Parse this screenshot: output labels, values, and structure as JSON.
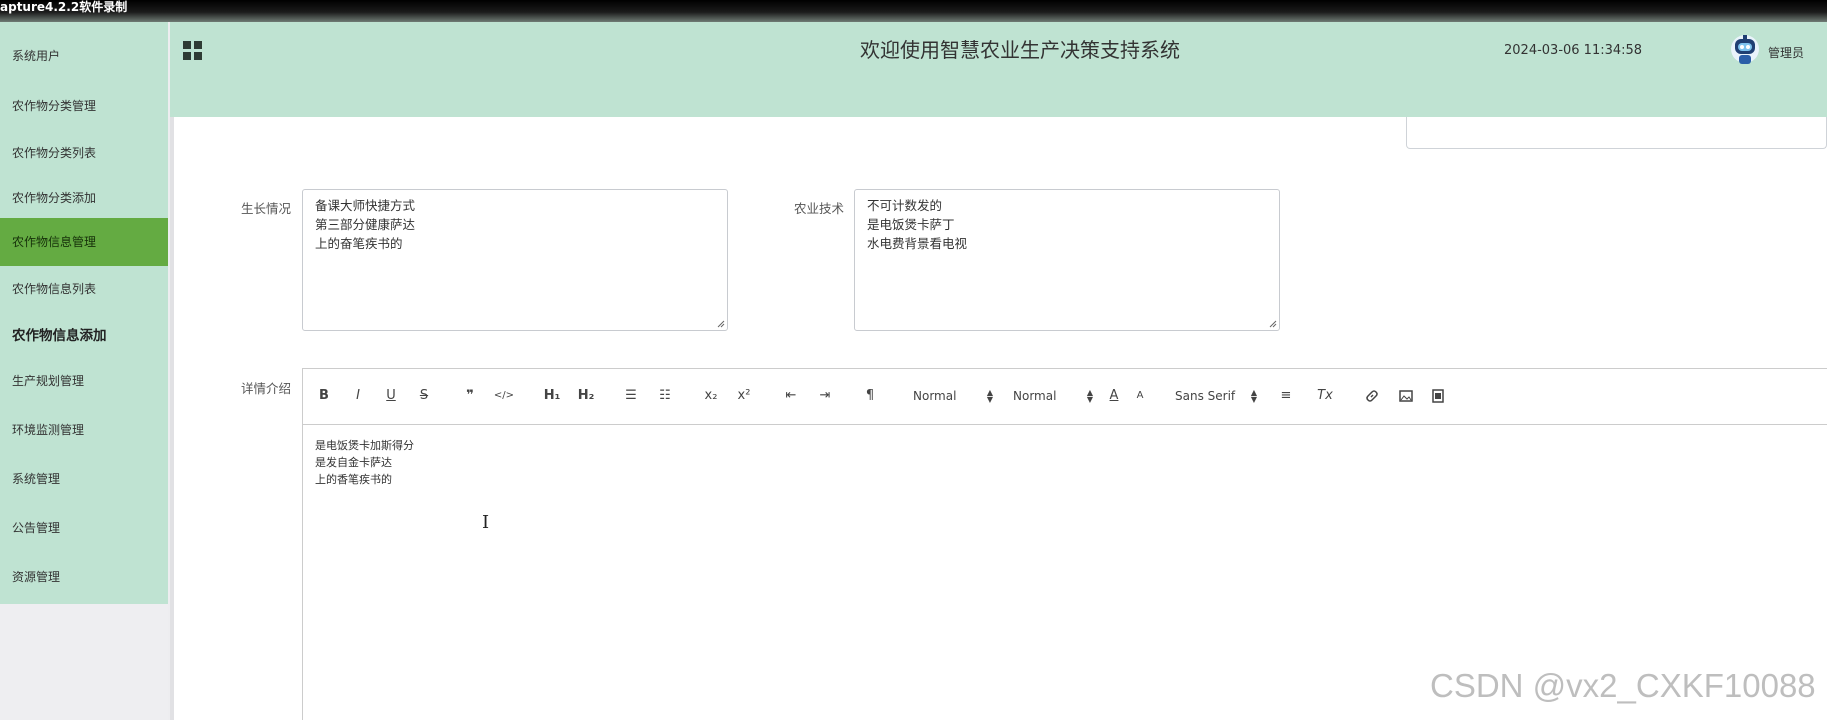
{
  "window": {
    "title": "apture4.2.2软件录制"
  },
  "sidebar": {
    "items": [
      {
        "label": "系统用户",
        "state": "normal"
      },
      {
        "label": "农作物分类管理",
        "state": "normal"
      },
      {
        "label": "农作物分类列表",
        "state": "normal"
      },
      {
        "label": "农作物分类添加",
        "state": "normal"
      },
      {
        "label": "农作物信息管理",
        "state": "active"
      },
      {
        "label": "农作物信息列表",
        "state": "normal"
      },
      {
        "label": "农作物信息添加",
        "state": "current"
      },
      {
        "label": "生产规划管理",
        "state": "normal"
      },
      {
        "label": "环境监测管理",
        "state": "normal"
      },
      {
        "label": "系统管理",
        "state": "normal"
      },
      {
        "label": "公告管理",
        "state": "normal"
      },
      {
        "label": "资源管理",
        "state": "normal"
      }
    ]
  },
  "header": {
    "menu_icon": "grid-icon",
    "title": "欢迎使用智慧农业生产决策支持系统",
    "datetime": "2024-03-06 11:34:58",
    "avatar_icon": "robot-avatar",
    "username": "管理员"
  },
  "form": {
    "growth": {
      "label": "生长情况",
      "lines": [
        "备课大师快捷方式",
        "第三部分健康萨达",
        "上的奋笔疾书的"
      ]
    },
    "tech": {
      "label": "农业技术",
      "lines": [
        "不可计数发的",
        "是电饭煲卡萨丁",
        "水电费背景看电视"
      ]
    },
    "detail": {
      "label": "详情介绍",
      "toolbar": {
        "bold": "B",
        "italic": "I",
        "underline": "U",
        "strike": "S",
        "blockquote": "❞",
        "code": "</>",
        "h1": "H₁",
        "h2": "H₂",
        "ordered_list": "☰",
        "bullet_list": "☷",
        "subscript": "x₂",
        "superscript": "x²",
        "outdent": "⇤",
        "indent": "⇥",
        "direction": "¶",
        "header_select": "Normal",
        "size_select": "Normal",
        "font_select": "Sans Serif",
        "color_icon": "A",
        "background_icon": "A",
        "align_icon": "≡",
        "clean_icon": "Tx",
        "link_icon": "link-icon",
        "image_icon": "image-icon",
        "video_icon": "video-icon"
      },
      "content_lines": [
        "是电饭煲卡加斯得分",
        "是发自金卡萨达",
        "上的香笔疾书的"
      ]
    }
  },
  "watermark": "CSDN @vx2_CXKF10088",
  "colors": {
    "header_bg": "#bfe3d2",
    "sidebar_bg": "#bfe3d2",
    "active_item": "#64ab42"
  }
}
